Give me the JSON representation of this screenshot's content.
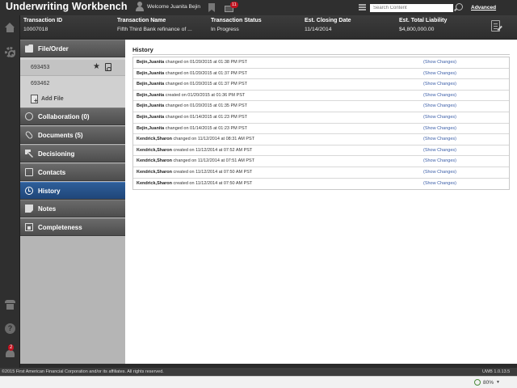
{
  "app": {
    "title": "Underwriting Workbench",
    "welcome": "Welcome Juanita Bejin",
    "mail_count": "11",
    "search_placeholder": "Search Content",
    "advanced_link": "Advanced"
  },
  "transaction": {
    "columns": [
      {
        "label": "Transaction ID",
        "value": "10007018"
      },
      {
        "label": "Transaction Name",
        "value": "Fifth Third Bank refinance of ..."
      },
      {
        "label": "Transaction Status",
        "value": "In Progress"
      },
      {
        "label": "Est. Closing Date",
        "value": "11/14/2014"
      },
      {
        "label": "Est. Total Liability",
        "value": "$4,800,000.00"
      }
    ]
  },
  "sidebar": {
    "file_order": {
      "label": "File/Order",
      "files": [
        "693453",
        "693462"
      ],
      "add_file": "Add File"
    },
    "items": [
      {
        "label": "Collaboration (0)"
      },
      {
        "label": "Documents (5)"
      },
      {
        "label": "Decisioning"
      },
      {
        "label": "Contacts"
      },
      {
        "label": "History"
      },
      {
        "label": "Notes"
      },
      {
        "label": "Completeness"
      }
    ]
  },
  "rail": {
    "notification_count": "2"
  },
  "history": {
    "title": "History",
    "rows": [
      {
        "user": "Bejin,Juanita",
        "text": "changed on 01/20/2015 at 01:38 PM PST",
        "link": "(Show Changes)"
      },
      {
        "user": "Bejin,Juanita",
        "text": "changed on 01/20/2015 at 01:37 PM PST",
        "link": "(Show Changes)"
      },
      {
        "user": "Bejin,Juanita",
        "text": "changed on 01/20/2015 at 01:37 PM PST",
        "link": "(Show Changes)"
      },
      {
        "user": "Bejin,Juanita",
        "text": "created on 01/20/2015 at 01:36 PM PST",
        "link": "(Show Changes)"
      },
      {
        "user": "Bejin,Juanita",
        "text": "changed on 01/20/2015 at 01:35 PM PST",
        "link": "(Show Changes)"
      },
      {
        "user": "Bejin,Juanita",
        "text": "changed on 01/14/2015 at 01:23 PM PST",
        "link": "(Show Changes)"
      },
      {
        "user": "Bejin,Juanita",
        "text": "changed on 01/14/2015 at 01:23 PM PST",
        "link": "(Show Changes)"
      },
      {
        "user": "Kendrick,Sharon",
        "text": "changed on 11/12/2014 at 08:31 AM PST",
        "link": "(Show Changes)"
      },
      {
        "user": "Kendrick,Sharon",
        "text": "created on 11/12/2014 at 07:52 AM PST",
        "link": "(Show Changes)"
      },
      {
        "user": "Kendrick,Sharon",
        "text": "changed on 11/12/2014 at 07:51 AM PST",
        "link": "(Show Changes)"
      },
      {
        "user": "Kendrick,Sharon",
        "text": "created on 11/12/2014 at 07:50 AM PST",
        "link": "(Show Changes)"
      },
      {
        "user": "Kendrick,Sharon",
        "text": "created on 11/12/2014 at 07:50 AM PST",
        "link": "(Show Changes)"
      }
    ]
  },
  "footer": {
    "copyright": "©2015 First American Financial Corporation and/or its affiliates. All rights reserved.",
    "version": "UWB 1.0.13.5"
  },
  "statusbar": {
    "zoom": "80%"
  },
  "colors": {
    "active_nav": "#1f4679",
    "link": "#3b5ea8",
    "badge": "#c1121f"
  }
}
